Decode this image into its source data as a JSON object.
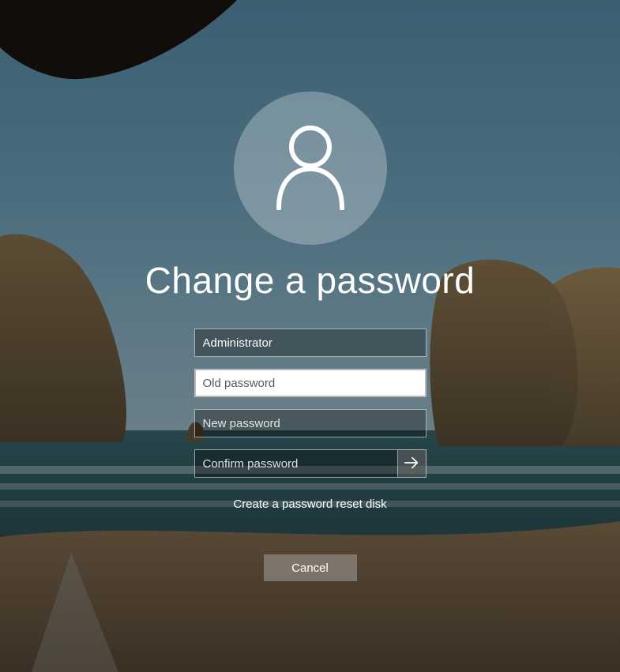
{
  "title": "Change a password",
  "username": {
    "value": "Administrator"
  },
  "old_password": {
    "placeholder": "Old password",
    "value": ""
  },
  "new_password": {
    "placeholder": "New password",
    "value": ""
  },
  "confirm_password": {
    "placeholder": "Confirm password",
    "value": ""
  },
  "reset_link": "Create a password reset disk",
  "cancel_label": "Cancel"
}
